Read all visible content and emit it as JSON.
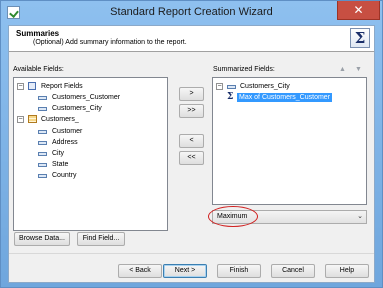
{
  "window": {
    "title": "Standard Report Creation Wizard",
    "close_glyph": "✕",
    "icon": "app-checkmark-icon"
  },
  "header": {
    "title": "Summaries",
    "subtitle": "(Optional) Add summary information to the report.",
    "icon_glyph": "Σ"
  },
  "available_fields": {
    "label": "Available Fields:",
    "tree": [
      {
        "label": "Report Fields",
        "icon": "report-icon",
        "expander": "−"
      },
      {
        "label": "Customers_Customer",
        "icon": "field-icon"
      },
      {
        "label": "Customers_City",
        "icon": "field-icon"
      },
      {
        "label": "Customers_",
        "icon": "table-icon",
        "expander": "−"
      },
      {
        "label": "Customer",
        "icon": "field-icon"
      },
      {
        "label": "Address",
        "icon": "field-icon"
      },
      {
        "label": "City",
        "icon": "field-icon"
      },
      {
        "label": "State",
        "icon": "field-icon"
      },
      {
        "label": "Country",
        "icon": "field-icon"
      }
    ]
  },
  "move_buttons": {
    "add": ">",
    "add_all": ">>",
    "remove": "<",
    "remove_all": "<<"
  },
  "summarized_fields": {
    "label": "Summarized Fields:",
    "tree": [
      {
        "label": "Customers_City",
        "icon": "field-icon",
        "expander": "−"
      },
      {
        "label": "Max of Customers_Customer",
        "icon": "sigma-icon",
        "selected": true
      }
    ],
    "up_arrow": "▲",
    "down_arrow": "▼"
  },
  "summary_operation": {
    "selected": "Maximum",
    "dropdown_glyph": "⌄"
  },
  "buttons": {
    "browse_data": "Browse Data...",
    "find_field": "Find Field...",
    "back": "< Back",
    "next": "Next >",
    "finish": "Finish",
    "cancel": "Cancel",
    "help": "Help"
  },
  "colors": {
    "selection": "#3399ff",
    "annotation_ellipse": "#d02020",
    "close_button": "#c74f42"
  }
}
